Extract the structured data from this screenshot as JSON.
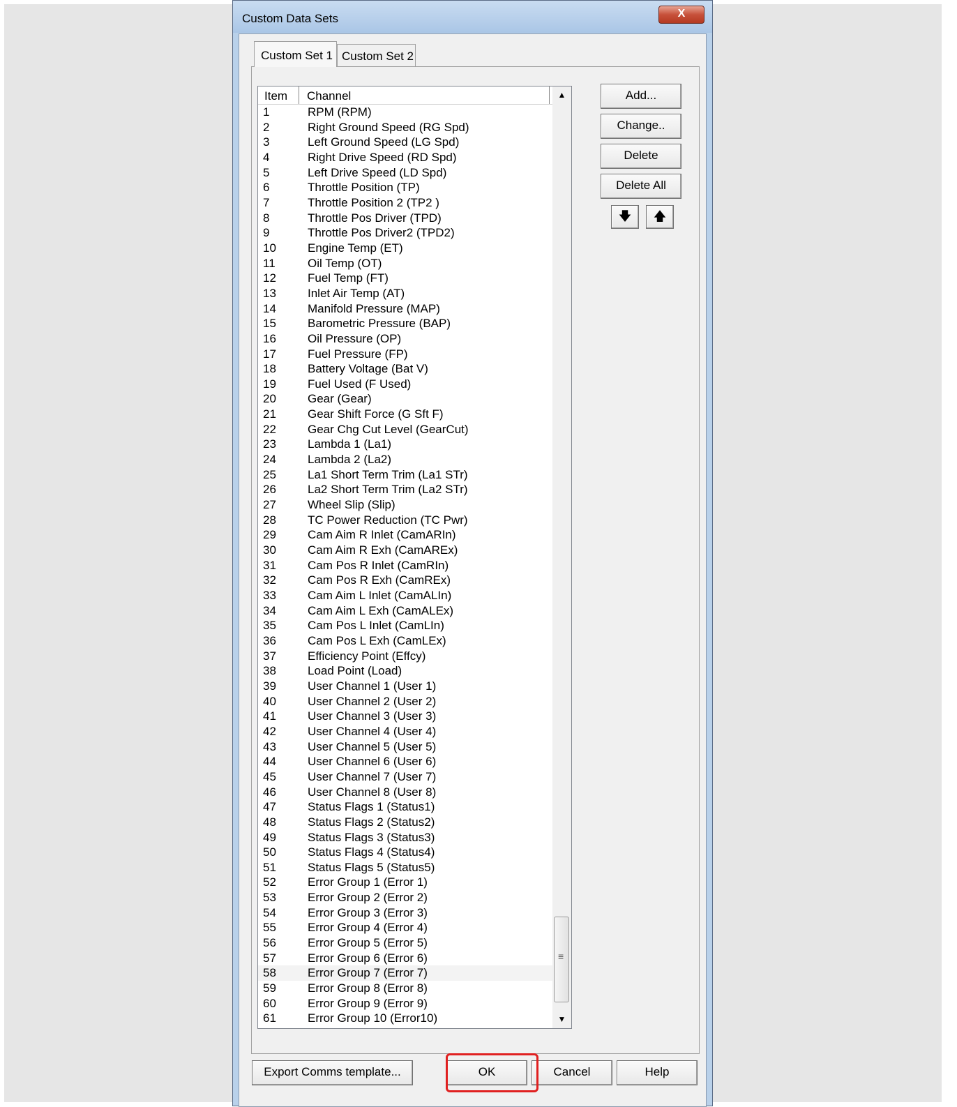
{
  "window": {
    "title": "Custom Data Sets",
    "close_glyph": "X"
  },
  "tabs": [
    {
      "label": "Custom Set 1"
    },
    {
      "label": "Custom Set 2"
    }
  ],
  "list": {
    "columns": {
      "item": "Item",
      "channel": "Channel"
    },
    "rows": [
      {
        "n": "1",
        "c": "RPM (RPM)"
      },
      {
        "n": "2",
        "c": "Right Ground Speed (RG Spd)"
      },
      {
        "n": "3",
        "c": "Left Ground Speed (LG Spd)"
      },
      {
        "n": "4",
        "c": "Right Drive Speed (RD Spd)"
      },
      {
        "n": "5",
        "c": "Left Drive Speed (LD Spd)"
      },
      {
        "n": "6",
        "c": "Throttle Position (TP)"
      },
      {
        "n": "7",
        "c": "Throttle Position 2 (TP2 )"
      },
      {
        "n": "8",
        "c": "Throttle Pos Driver (TPD)"
      },
      {
        "n": "9",
        "c": "Throttle Pos Driver2 (TPD2)"
      },
      {
        "n": "10",
        "c": "Engine Temp (ET)"
      },
      {
        "n": "11",
        "c": "Oil Temp (OT)"
      },
      {
        "n": "12",
        "c": "Fuel Temp (FT)"
      },
      {
        "n": "13",
        "c": "Inlet Air Temp (AT)"
      },
      {
        "n": "14",
        "c": "Manifold Pressure (MAP)"
      },
      {
        "n": "15",
        "c": "Barometric Pressure (BAP)"
      },
      {
        "n": "16",
        "c": "Oil Pressure (OP)"
      },
      {
        "n": "17",
        "c": "Fuel Pressure (FP)"
      },
      {
        "n": "18",
        "c": "Battery Voltage (Bat V)"
      },
      {
        "n": "19",
        "c": "Fuel Used (F Used)"
      },
      {
        "n": "20",
        "c": "Gear (Gear)"
      },
      {
        "n": "21",
        "c": "Gear Shift Force (G Sft F)"
      },
      {
        "n": "22",
        "c": "Gear Chg Cut Level (GearCut)"
      },
      {
        "n": "23",
        "c": "Lambda 1 (La1)"
      },
      {
        "n": "24",
        "c": "Lambda 2 (La2)"
      },
      {
        "n": "25",
        "c": "La1 Short Term Trim (La1 STr)"
      },
      {
        "n": "26",
        "c": "La2 Short Term Trim (La2 STr)"
      },
      {
        "n": "27",
        "c": "Wheel Slip (Slip)"
      },
      {
        "n": "28",
        "c": "TC Power Reduction (TC Pwr)"
      },
      {
        "n": "29",
        "c": "Cam Aim R Inlet (CamARIn)"
      },
      {
        "n": "30",
        "c": "Cam Aim R Exh (CamAREx)"
      },
      {
        "n": "31",
        "c": "Cam Pos R Inlet (CamRIn)"
      },
      {
        "n": "32",
        "c": "Cam Pos R Exh (CamREx)"
      },
      {
        "n": "33",
        "c": "Cam Aim L Inlet (CamALIn)"
      },
      {
        "n": "34",
        "c": "Cam Aim L Exh (CamALEx)"
      },
      {
        "n": "35",
        "c": "Cam Pos L Inlet (CamLIn)"
      },
      {
        "n": "36",
        "c": "Cam Pos L Exh (CamLEx)"
      },
      {
        "n": "37",
        "c": "Efficiency Point (Effcy)"
      },
      {
        "n": "38",
        "c": "Load Point (Load)"
      },
      {
        "n": "39",
        "c": "User Channel 1 (User 1)"
      },
      {
        "n": "40",
        "c": "User Channel 2 (User 2)"
      },
      {
        "n": "41",
        "c": "User Channel 3 (User 3)"
      },
      {
        "n": "42",
        "c": "User Channel 4 (User 4)"
      },
      {
        "n": "43",
        "c": "User Channel 5 (User 5)"
      },
      {
        "n": "44",
        "c": "User Channel 6 (User 6)"
      },
      {
        "n": "45",
        "c": "User Channel 7 (User 7)"
      },
      {
        "n": "46",
        "c": "User Channel 8 (User 8)"
      },
      {
        "n": "47",
        "c": "Status Flags 1 (Status1)"
      },
      {
        "n": "48",
        "c": "Status Flags 2 (Status2)"
      },
      {
        "n": "49",
        "c": "Status Flags 3 (Status3)"
      },
      {
        "n": "50",
        "c": "Status Flags 4 (Status4)"
      },
      {
        "n": "51",
        "c": "Status Flags 5 (Status5)"
      },
      {
        "n": "52",
        "c": "Error Group 1 (Error 1)"
      },
      {
        "n": "53",
        "c": "Error Group 2 (Error 2)"
      },
      {
        "n": "54",
        "c": "Error Group 3 (Error 3)"
      },
      {
        "n": "55",
        "c": "Error Group 4 (Error 4)"
      },
      {
        "n": "56",
        "c": "Error Group 5 (Error 5)"
      },
      {
        "n": "57",
        "c": "Error Group 6 (Error 6)"
      },
      {
        "n": "58",
        "c": "Error Group 7 (Error 7)"
      },
      {
        "n": "59",
        "c": "Error Group 8 (Error 8)"
      },
      {
        "n": "60",
        "c": "Error Group 9 (Error 9)"
      },
      {
        "n": "61",
        "c": "Error Group 10 (Error10)"
      }
    ],
    "hovered_row": "58"
  },
  "side_buttons": {
    "add": "Add...",
    "change": "Change..",
    "delete": "Delete",
    "delete_all": "Delete All",
    "move_down_icon": "arrow-down-icon",
    "move_up_icon": "arrow-up-icon"
  },
  "bottom_buttons": {
    "export": "Export Comms template...",
    "ok": "OK",
    "cancel": "Cancel",
    "help": "Help"
  },
  "colors": {
    "highlight": "#e02020",
    "title_bar": "#b9d1ea",
    "dialog": "#f0f0f0"
  }
}
